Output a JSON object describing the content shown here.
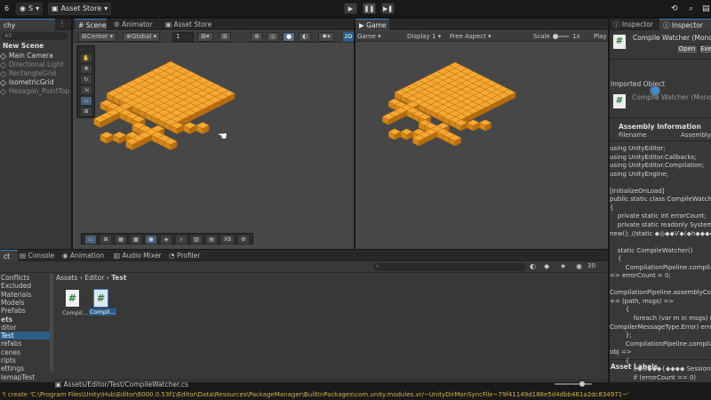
{
  "topbar": {
    "unity_logo": "6",
    "account_label": "S",
    "asset_store_label": "Asset Store",
    "asset_store_chevron": "▾",
    "account_chevron": "▾"
  },
  "hierarchy": {
    "tab_label": "chy",
    "search_placeholder": "All",
    "scene_name": "New Scene",
    "items": [
      {
        "label": "Main Camera",
        "disabled": false
      },
      {
        "label": "Directional Light",
        "disabled": true
      },
      {
        "label": "RectangleGrid",
        "disabled": true
      },
      {
        "label": "IsometricGrid",
        "disabled": false
      },
      {
        "label": "Hexagon_PointTop",
        "disabled": true
      }
    ]
  },
  "scene_view": {
    "tabs": [
      "Scene",
      "Animator",
      "Asset Store"
    ],
    "pivot_label": "Center",
    "space_label": "Global",
    "grid_value": "1",
    "mode_2d": "2D",
    "bottom_toolbar_label": "XB"
  },
  "game_view": {
    "tab_label": "Game",
    "mode_label": "Game",
    "display_label": "Display 1",
    "aspect_label": "Free Aspect",
    "scale_label": "Scale",
    "scale_value": "1x",
    "play_label": "Play"
  },
  "inspector": {
    "tab1_label": "Inspector",
    "tab2_label": "Inspector",
    "title": "Compile Watcher (Mono",
    "open_label": "Open",
    "exec_label": "Exe",
    "imported_object_label": "Imported Object",
    "imported_title": "Compile Watcher (Mono",
    "assembly_info_label": "Assembly Information",
    "filename_header": "Filename",
    "assembly_header": "Assembly",
    "asset_labels": "Asset Labels",
    "code_lines": [
      "using UnityEditor;",
      "using UnityEditor.Callbacks;",
      "using UnityEditor.Compilation;",
      "using UnityEngine;",
      "",
      "[InitializeOnLoad]",
      "public static class CompileWatcher",
      "{",
      "    private static int errorCount;",
      "    private static readonly System.F",
      "new(); //static ◆◎◆◆Ѵ◆(◆h◆◆◆◆□◆",
      "",
      "    static CompileWatcher()",
      "    {",
      "        CompilationPipeline.compilatio",
      "=> errorCount = 0;",
      "",
      "CompilationPipeline.assemblyCom",
      "+= (path, msgs) =>",
      "        {",
      "            foreach (var m in msgs) if (",
      "CompilerMessageType.Error) error",
      "        };",
      "        CompilationPipeline.compilatio",
      "obj =>",
      "        {",
      "            //◆G◆◆◆{◆◆◆◆ SessionStat",
      "            if (errorCount == 0)"
    ]
  },
  "bottom": {
    "tabs": [
      "ct",
      "Console",
      "Animation",
      "Audio Mixer",
      "Profiler"
    ],
    "badge_count": "30",
    "breadcrumb": [
      "Assets",
      "Editor",
      "Test"
    ],
    "tree_items": [
      "Conflicts",
      "Excluded",
      "Materials",
      "Models",
      "Prefabs",
      "ets",
      "ditor",
      "Test",
      "refabs",
      "cenes",
      "ripts",
      "ettings",
      "lemapTest"
    ],
    "selected_tree_item": "Test",
    "files": [
      {
        "label": "Compil...",
        "selected": false
      },
      {
        "label": "Compil...",
        "selected": true
      }
    ],
    "path_label": "Assets/Editor/Test/CompileWatcher.cs"
  },
  "status_bar": {
    "message": "'t create 'C:\\Program Files\\Unity\\Hub\\Editor\\6000.0.53f1\\Editor\\Data\\Resources\\PackageManager\\BuiltInPackages\\com.unity.modules.vr/~UnityDirMonSyncFile~79f41149d186e5d4dbb461a2dc834971~'"
  },
  "colors": {
    "cube_top": "#f5a833",
    "cube_left": "#d4861a",
    "cube_right": "#b56e0e",
    "accent": "#3a79bb",
    "status_text": "#d9b04a"
  }
}
